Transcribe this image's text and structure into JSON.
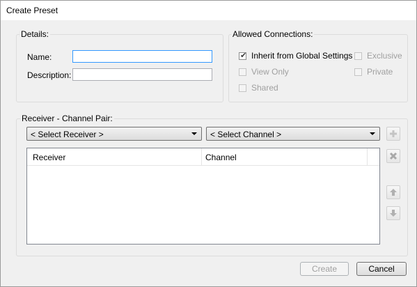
{
  "window": {
    "title": "Create Preset"
  },
  "details": {
    "group_label": "Details:",
    "name_label": "Name:",
    "name_value": "",
    "description_label": "Description:",
    "description_value": ""
  },
  "connections": {
    "group_label": "Allowed Connections:",
    "options": [
      {
        "label": "Inherit from Global Settings",
        "checked": true,
        "enabled": true
      },
      {
        "label": "View Only",
        "checked": false,
        "enabled": false
      },
      {
        "label": "Shared",
        "checked": false,
        "enabled": false
      },
      {
        "label": "Exclusive",
        "checked": false,
        "enabled": false
      },
      {
        "label": "Private",
        "checked": false,
        "enabled": false
      }
    ]
  },
  "pair": {
    "group_label": "Receiver - Channel Pair:",
    "receiver_combo": "< Select Receiver >",
    "channel_combo": "< Select Channel >",
    "columns": [
      "Receiver",
      "Channel"
    ],
    "side_buttons": [
      "add-icon",
      "remove-icon",
      "move-up-icon",
      "move-down-icon"
    ]
  },
  "footer": {
    "create_label": "Create",
    "cancel_label": "Cancel"
  }
}
